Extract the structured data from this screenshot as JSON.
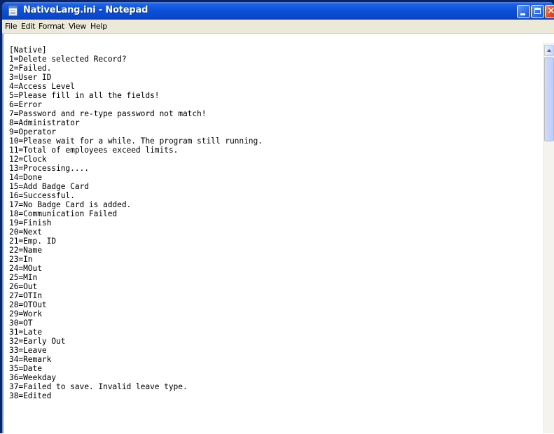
{
  "window": {
    "title": "NativeLang.ini - Notepad"
  },
  "menu": {
    "items": [
      "File",
      "Edit",
      "Format",
      "View",
      "Help"
    ]
  },
  "editor": {
    "lines": [
      "[Native]",
      "1=Delete selected Record?",
      "2=Failed.",
      "3=User ID",
      "4=Access Level",
      "5=Please fill in all the fields!",
      "6=Error",
      "7=Password and re-type password not match!",
      "8=Administrator",
      "9=Operator",
      "10=Please wait for a while. The program still running.",
      "11=Total of employees exceed limits.",
      "12=Clock",
      "13=Processing....",
      "14=Done",
      "15=Add Badge Card",
      "16=Successful.",
      "17=No Badge Card is added.",
      "18=Communication Failed",
      "19=Finish",
      "20=Next",
      "21=Emp. ID",
      "22=Name",
      "23=In",
      "24=MOut",
      "25=MIn",
      "26=Out",
      "27=OTIn",
      "28=OTOut",
      "29=Work",
      "30=OT",
      "31=Late",
      "32=Early Out",
      "33=Leave",
      "34=Remark",
      "35=Date",
      "36=Weekday",
      "37=Failed to save. Invalid leave type.",
      "38=Edited"
    ]
  },
  "icons": {
    "app": "notepad-icon",
    "minimize": "minimize-icon",
    "maximize": "maximize-icon",
    "close": "close-icon",
    "scroll_up": "chevron-up-icon"
  }
}
